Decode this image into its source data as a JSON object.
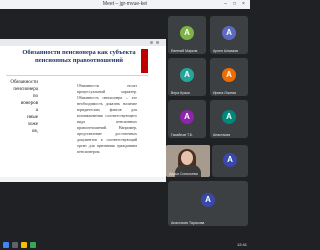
{
  "window": {
    "title": "Meet – jgr-mvue-kei"
  },
  "slide": {
    "title": "Обязанности пенсионера как субъекта пенсионных правоотношений",
    "left_lines": [
      "Обязанности",
      "пенсионера",
      "по",
      "ионеров",
      "а",
      "нные",
      "хоже",
      "ов,"
    ],
    "right_text": "Обязанности носят процессуальный характер. Обязанность пенсионера – это необходимость доказать наличие юридических фактов для возникновения соответствующего вида пенсионных правоотношений. Например, представление достаточных документов в соответствующий орган для признания гражданина пенсионером."
  },
  "participants": [
    {
      "initial": "A",
      "name": "Евгений Марков",
      "color": "#7cb342"
    },
    {
      "initial": "A",
      "name": "Арсен Алмазов",
      "color": "#5c6bc0"
    },
    {
      "initial": "A",
      "name": "Вера Кузьм",
      "color": "#26a69a"
    },
    {
      "initial": "A",
      "name": "Ирина Лосева",
      "color": "#ef6c00"
    },
    {
      "initial": "A",
      "name": "Гасайнов Т.Б.",
      "color": "#8e24aa"
    },
    {
      "initial": "A",
      "name": "Анастасия",
      "color": "#00897b"
    },
    {
      "initial": "A",
      "name": "Дарья Солосьева",
      "color": "#d81b60"
    },
    {
      "initial": "A",
      "name": "Анастасия Тарасова",
      "color": "#3949ab"
    }
  ],
  "taskbar": {
    "time": "12:41"
  }
}
